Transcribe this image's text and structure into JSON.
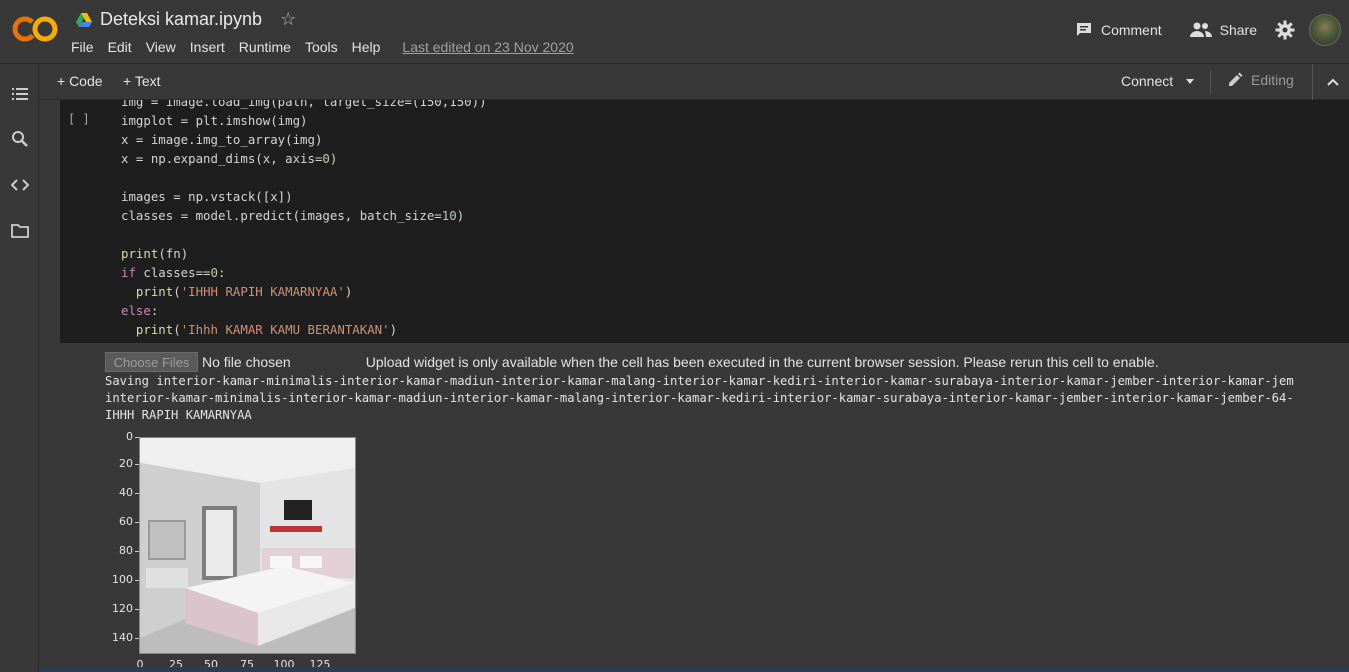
{
  "header": {
    "logo_text": "CO",
    "title": "Deteksi kamar.ipynb",
    "menus": [
      "File",
      "Edit",
      "View",
      "Insert",
      "Runtime",
      "Tools",
      "Help"
    ],
    "last_edited": "Last edited on 23 Nov 2020",
    "comment_label": "Comment",
    "share_label": "Share"
  },
  "toolbar": {
    "code_label": "+ Code",
    "text_label": "+ Text",
    "connect_label": "Connect",
    "editing_label": "Editing"
  },
  "cell": {
    "run_indicator": "[ ]"
  },
  "output": {
    "choose_files": "Choose Files",
    "no_file": "No file chosen",
    "upload_message": "Upload widget is only available when the cell has been executed in the current browser session. Please rerun this cell to enable.",
    "saving_line": "Saving interior-kamar-minimalis-interior-kamar-madiun-interior-kamar-malang-interior-kamar-kediri-interior-kamar-surabaya-interior-kamar-jember-interior-kamar-jem",
    "filename_line": "interior-kamar-minimalis-interior-kamar-madiun-interior-kamar-malang-interior-kamar-kediri-interior-kamar-surabaya-interior-kamar-jember-interior-kamar-jember-64-",
    "result_line": "IHHH RAPIH KAMARNYAA"
  },
  "plot": {
    "yticks": [
      "0",
      "20",
      "40",
      "60",
      "80",
      "100",
      "120",
      "140"
    ],
    "xticks": [
      "0",
      "25",
      "50",
      "75",
      "100",
      "125"
    ]
  },
  "colors": {
    "background": "#383838",
    "code_bg": "#1e1e1e",
    "logo_orange": "#f9ab00",
    "logo_dark": "#e8710a"
  }
}
